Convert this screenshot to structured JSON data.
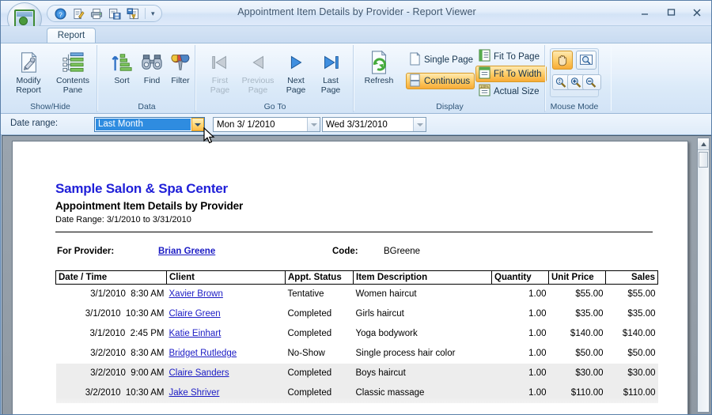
{
  "window": {
    "title": "Appointment Item Details by Provider - Report Viewer",
    "app_button": "report-viewer-app-button",
    "minimize": "–",
    "maximize": "□",
    "close": "✕"
  },
  "quick_access": {
    "items": [
      {
        "name": "help-icon",
        "label": "Help"
      },
      {
        "name": "modify-report-icon",
        "label": "Modify Report"
      },
      {
        "name": "print-icon",
        "label": "Print"
      },
      {
        "name": "save-as-icon",
        "label": "Save As"
      },
      {
        "name": "export-icon",
        "label": "Export"
      }
    ],
    "more_label": "▾"
  },
  "tabs": [
    {
      "label": "Report",
      "active": true
    }
  ],
  "ribbon": {
    "groups": [
      {
        "label": "Show/Hide",
        "buttons": [
          {
            "label_line1": "Modify",
            "label_line2": "Report",
            "icon": "modify-report-icon",
            "enabled": true
          },
          {
            "label_line1": "Contents",
            "label_line2": "Pane",
            "icon": "contents-pane-icon",
            "enabled": true
          }
        ]
      },
      {
        "label": "Data",
        "buttons": [
          {
            "label_line1": "Sort",
            "label_line2": "",
            "icon": "sort-icon",
            "enabled": true
          },
          {
            "label_line1": "Find",
            "label_line2": "",
            "icon": "find-icon",
            "enabled": true
          },
          {
            "label_line1": "Filter",
            "label_line2": "",
            "icon": "filter-icon",
            "enabled": true
          }
        ]
      },
      {
        "label": "Go To",
        "buttons": [
          {
            "label_line1": "First",
            "label_line2": "Page",
            "icon": "first-page-icon",
            "enabled": false
          },
          {
            "label_line1": "Previous",
            "label_line2": "Page",
            "icon": "previous-page-icon",
            "enabled": false
          },
          {
            "label_line1": "Next",
            "label_line2": "Page",
            "icon": "next-page-icon",
            "enabled": true
          },
          {
            "label_line1": "Last",
            "label_line2": "Page",
            "icon": "last-page-icon",
            "enabled": true
          }
        ]
      },
      {
        "label": "Display",
        "refresh": {
          "label": "Refresh",
          "icon": "refresh-icon"
        },
        "toggles": [
          {
            "label": "Single Page",
            "icon": "single-page-icon",
            "active": false
          },
          {
            "label": "Continuous",
            "icon": "continuous-icon",
            "active": true
          },
          {
            "label": "Fit To Page",
            "icon": "fit-to-page-icon",
            "active": false
          },
          {
            "label": "Fit To Width",
            "icon": "fit-to-width-icon",
            "active": true
          },
          {
            "label": "Actual Size",
            "icon": "actual-size-icon",
            "active": false
          }
        ]
      },
      {
        "label": "Mouse Mode",
        "tools": [
          {
            "name": "pan-hand-tool",
            "active": true
          },
          {
            "name": "zoom-select-tool",
            "active": false
          }
        ],
        "zooms": [
          {
            "name": "zoom-fit-button"
          },
          {
            "name": "zoom-in-button"
          },
          {
            "name": "zoom-out-button"
          }
        ]
      }
    ]
  },
  "date_bar": {
    "label": "Date range:",
    "range_value": "Last Month",
    "range_selected": true,
    "start_date": "Mon   3/ 1/2010",
    "end_date": "Wed   3/31/2010"
  },
  "report": {
    "company": "Sample Salon & Spa Center",
    "title": "Appointment Item Details by Provider",
    "date_range_line": "Date Range: 3/1/2010 to 3/31/2010",
    "provider_label": "For Provider:",
    "provider_name": "Brian Greene",
    "code_label": "Code:",
    "code_value": "BGreene",
    "columns": [
      {
        "label": "Date / Time",
        "align": "left"
      },
      {
        "label": "Client",
        "align": "left"
      },
      {
        "label": "Appt. Status",
        "align": "left"
      },
      {
        "label": "Item Description",
        "align": "left"
      },
      {
        "label": "Quantity",
        "align": "left"
      },
      {
        "label": "Unit Price",
        "align": "left"
      },
      {
        "label": "Sales",
        "align": "right"
      }
    ],
    "rows": [
      {
        "date": "3/1/2010",
        "time": "8:30 AM",
        "client": "Xavier Brown",
        "status": "Tentative",
        "item": "Women haircut",
        "qty": "1.00",
        "unit_price": "$55.00",
        "sales": "$55.00",
        "shaded": false
      },
      {
        "date": "3/1/2010",
        "time": "10:30 AM",
        "client": "Claire Green",
        "status": "Completed",
        "item": "Girls haircut",
        "qty": "1.00",
        "unit_price": "$35.00",
        "sales": "$35.00",
        "shaded": false
      },
      {
        "date": "3/1/2010",
        "time": "2:45 PM",
        "client": "Katie Einhart",
        "status": "Completed",
        "item": "Yoga bodywork",
        "qty": "1.00",
        "unit_price": "$140.00",
        "sales": "$140.00",
        "shaded": false
      },
      {
        "date": "3/2/2010",
        "time": "8:30 AM",
        "client": "Bridget Rutledge",
        "status": "No-Show",
        "item": "Single process hair color",
        "qty": "1.00",
        "unit_price": "$50.00",
        "sales": "$50.00",
        "shaded": false
      },
      {
        "date": "3/2/2010",
        "time": "9:00 AM",
        "client": "Claire Sanders",
        "status": "Completed",
        "item": "Boys haircut",
        "qty": "1.00",
        "unit_price": "$30.00",
        "sales": "$30.00",
        "shaded": true
      },
      {
        "date": "3/2/2010",
        "time": "10:30 AM",
        "client": "Jake Shriver",
        "status": "Completed",
        "item": "Classic massage",
        "qty": "1.00",
        "unit_price": "$110.00",
        "sales": "$110.00",
        "shaded": true
      }
    ]
  },
  "colors": {
    "accent_blue": "#1f1fd8",
    "link_blue": "#1b1bc4",
    "ribbon_highlight": "#f7ab37",
    "selection_blue": "#2f8ce0"
  }
}
